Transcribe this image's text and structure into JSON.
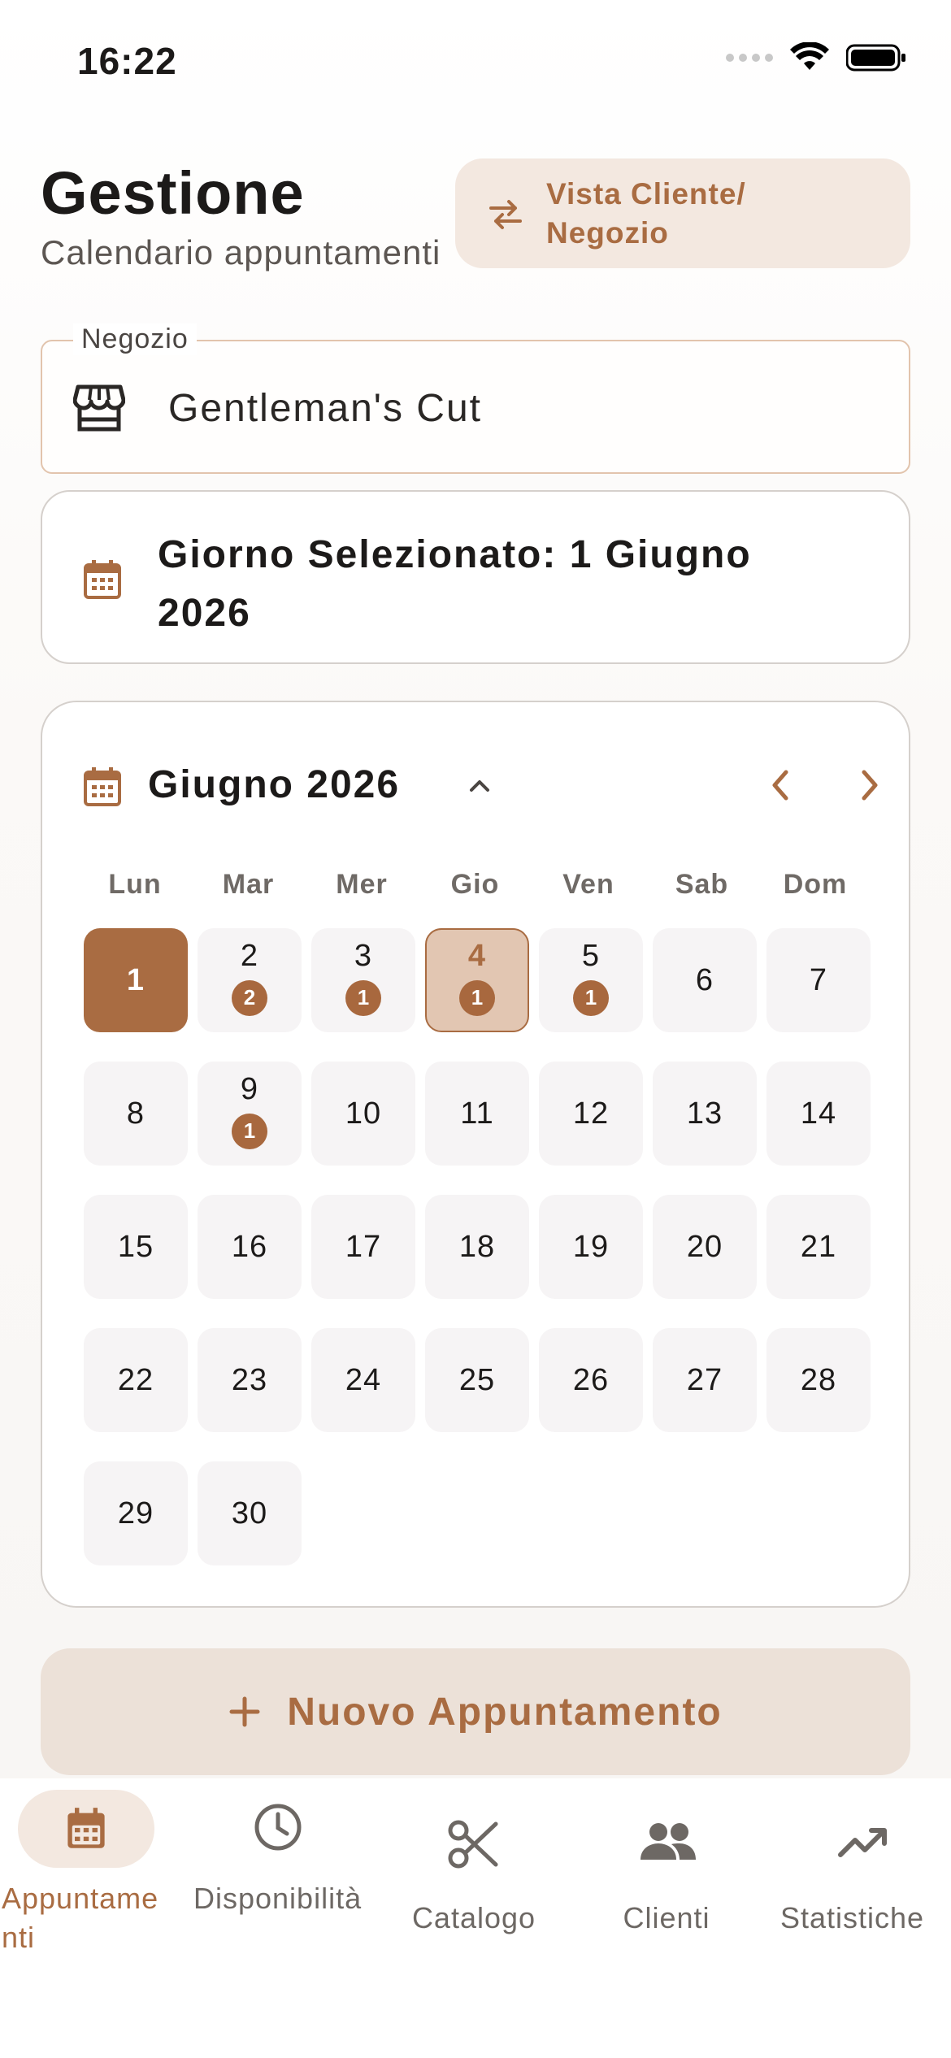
{
  "status_bar": {
    "time": "16:22"
  },
  "header": {
    "title": "Gestione",
    "subtitle": "Calendario appuntamenti",
    "toggle_label": "Vista Cliente/ Negozio"
  },
  "shop_field": {
    "label": "Negozio",
    "value": "Gentleman's Cut"
  },
  "selected_day": {
    "text": "Giorno Selezionato: 1 Giugno 2026"
  },
  "calendar": {
    "month_label": "Giugno 2026",
    "weekdays": [
      "Lun",
      "Mar",
      "Mer",
      "Gio",
      "Ven",
      "Sab",
      "Dom"
    ],
    "days": [
      {
        "n": "1",
        "badge": null,
        "state": "selected"
      },
      {
        "n": "2",
        "badge": "2",
        "state": ""
      },
      {
        "n": "3",
        "badge": "1",
        "state": ""
      },
      {
        "n": "4",
        "badge": "1",
        "state": "today"
      },
      {
        "n": "5",
        "badge": "1",
        "state": ""
      },
      {
        "n": "6",
        "badge": null,
        "state": ""
      },
      {
        "n": "7",
        "badge": null,
        "state": ""
      },
      {
        "n": "8",
        "badge": null,
        "state": ""
      },
      {
        "n": "9",
        "badge": "1",
        "state": ""
      },
      {
        "n": "10",
        "badge": null,
        "state": ""
      },
      {
        "n": "11",
        "badge": null,
        "state": ""
      },
      {
        "n": "12",
        "badge": null,
        "state": ""
      },
      {
        "n": "13",
        "badge": null,
        "state": ""
      },
      {
        "n": "14",
        "badge": null,
        "state": ""
      },
      {
        "n": "15",
        "badge": null,
        "state": ""
      },
      {
        "n": "16",
        "badge": null,
        "state": ""
      },
      {
        "n": "17",
        "badge": null,
        "state": ""
      },
      {
        "n": "18",
        "badge": null,
        "state": ""
      },
      {
        "n": "19",
        "badge": null,
        "state": ""
      },
      {
        "n": "20",
        "badge": null,
        "state": ""
      },
      {
        "n": "21",
        "badge": null,
        "state": ""
      },
      {
        "n": "22",
        "badge": null,
        "state": ""
      },
      {
        "n": "23",
        "badge": null,
        "state": ""
      },
      {
        "n": "24",
        "badge": null,
        "state": ""
      },
      {
        "n": "25",
        "badge": null,
        "state": ""
      },
      {
        "n": "26",
        "badge": null,
        "state": ""
      },
      {
        "n": "27",
        "badge": null,
        "state": ""
      },
      {
        "n": "28",
        "badge": null,
        "state": ""
      },
      {
        "n": "29",
        "badge": null,
        "state": ""
      },
      {
        "n": "30",
        "badge": null,
        "state": ""
      }
    ]
  },
  "new_appointment": {
    "label": "Nuovo Appuntamento"
  },
  "bottom_nav": {
    "items": [
      {
        "label": "Appuntamenti",
        "icon": "calendar-icon",
        "active": true
      },
      {
        "label": "Disponibilità",
        "icon": "clock-icon",
        "active": false
      },
      {
        "label": "Catalogo",
        "icon": "scissors-icon",
        "active": false
      },
      {
        "label": "Clienti",
        "icon": "people-icon",
        "active": false
      },
      {
        "label": "Statistiche",
        "icon": "trending-up-icon",
        "active": false
      }
    ]
  },
  "colors": {
    "accent": "#a96c42",
    "accent_soft": "#f3e8e0",
    "badge": "#a8683e"
  }
}
